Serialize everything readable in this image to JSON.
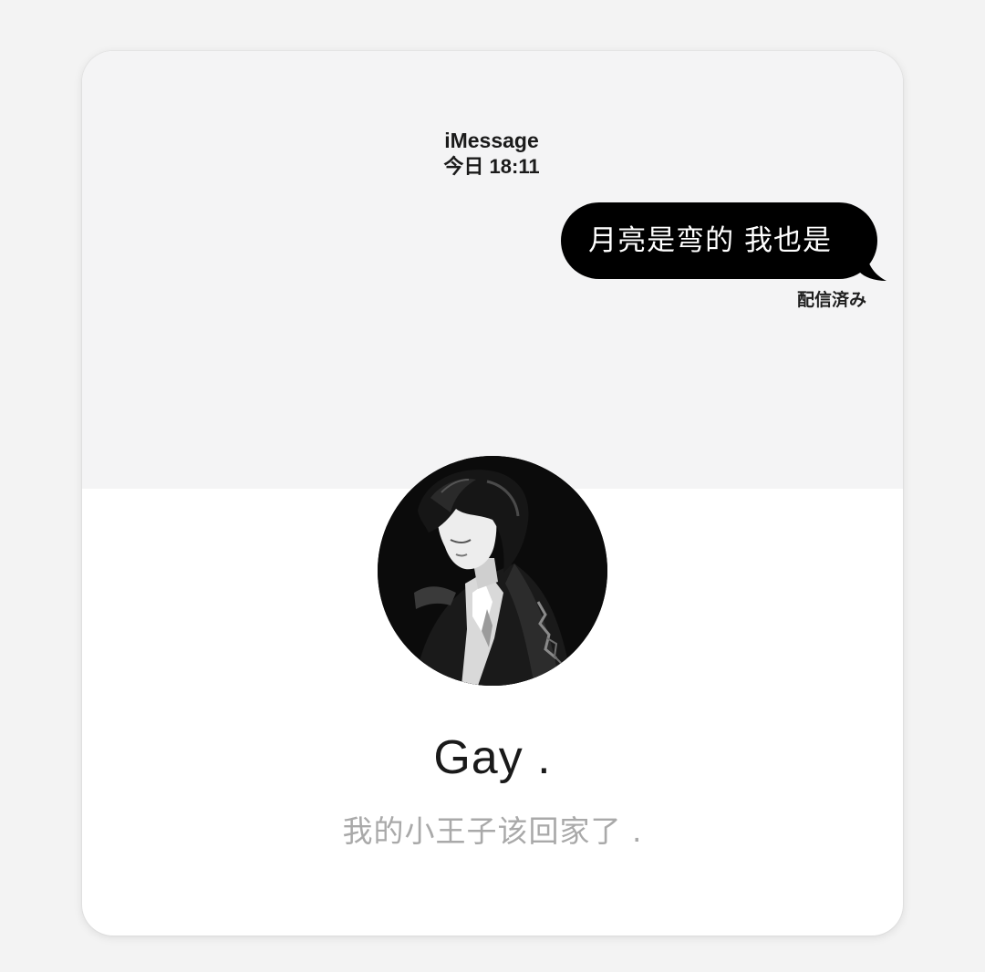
{
  "header": {
    "service": "iMessage",
    "time": "今日 18:11"
  },
  "message": {
    "text": "月亮是弯的 我也是",
    "status": "配信済み",
    "bubble_color": "#000000",
    "text_color": "#ffffff"
  },
  "profile": {
    "avatar": "anime-portrait-avatar",
    "name": "Gay .",
    "bio": "我的小王子该回家了 ."
  },
  "colors": {
    "card_top": "#f4f4f5",
    "card_bottom": "#ffffff",
    "bio_text": "#a9a9a9"
  }
}
